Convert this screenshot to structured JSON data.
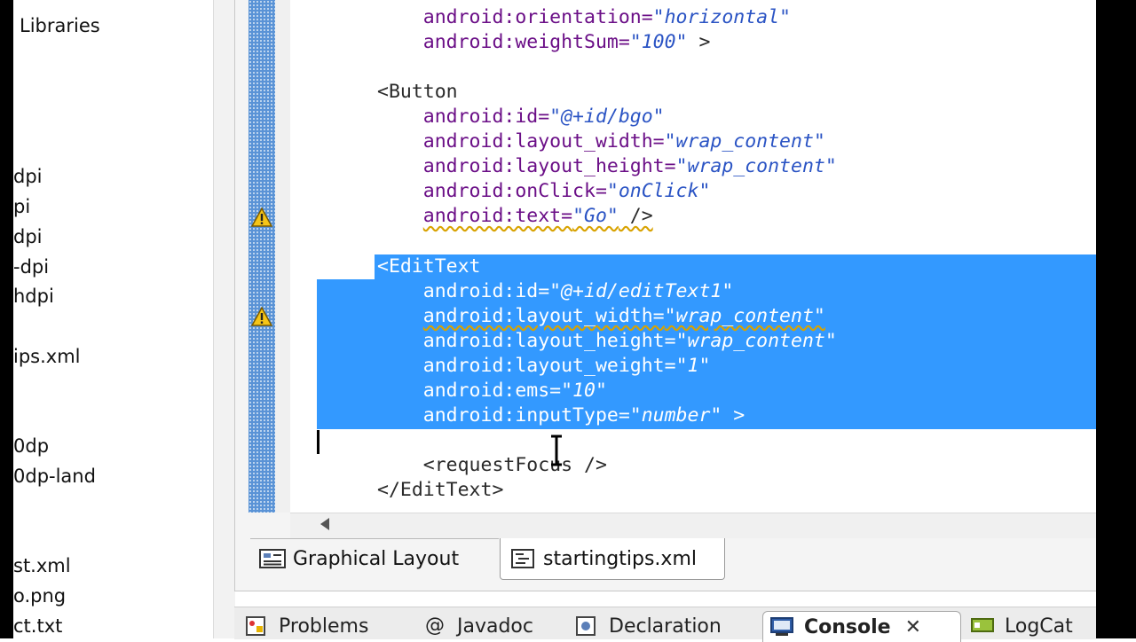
{
  "explorer": {
    "items": [
      "Libraries",
      "dpi",
      "pi",
      "dpi",
      "-dpi",
      "hdpi",
      "ips.xml",
      "0dp",
      "0dp-land",
      "st.xml",
      "o.png",
      "ct.txt"
    ]
  },
  "code": {
    "lines": [
      {
        "indent": "    ",
        "parts": [
          [
            "attr",
            "android:orientation="
          ],
          [
            "val",
            "\"horizontal\""
          ]
        ]
      },
      {
        "indent": "    ",
        "parts": [
          [
            "attr",
            "android:weightSum="
          ],
          [
            "val",
            "\"100\""
          ],
          [
            "tag",
            " >"
          ]
        ]
      },
      {
        "indent": "",
        "parts": []
      },
      {
        "indent": "",
        "parts": [
          [
            "tag",
            "<Button"
          ]
        ]
      },
      {
        "indent": "    ",
        "parts": [
          [
            "attr",
            "android:id="
          ],
          [
            "val",
            "\"@+id/bgo\""
          ]
        ]
      },
      {
        "indent": "    ",
        "parts": [
          [
            "attr",
            "android:layout_width="
          ],
          [
            "val",
            "\"wrap_content\""
          ]
        ]
      },
      {
        "indent": "    ",
        "parts": [
          [
            "attr",
            "android:layout_height="
          ],
          [
            "val",
            "\"wrap_content\""
          ]
        ]
      },
      {
        "indent": "    ",
        "parts": [
          [
            "attr",
            "android:onClick="
          ],
          [
            "val",
            "\"onClick\""
          ]
        ]
      },
      {
        "indent": "    ",
        "parts": [
          [
            "attr",
            "android:text="
          ],
          [
            "val",
            "\"Go\""
          ],
          [
            "tag",
            " />"
          ]
        ],
        "warning": true
      },
      {
        "indent": "",
        "parts": []
      },
      {
        "indent": "",
        "parts": [
          [
            "tag",
            "<EditText"
          ]
        ],
        "selected": true
      },
      {
        "indent": "    ",
        "parts": [
          [
            "attr",
            "android:id="
          ],
          [
            "val",
            "\"@+id/editText1\""
          ]
        ],
        "selected": true
      },
      {
        "indent": "    ",
        "parts": [
          [
            "attr",
            "android:layout_width="
          ],
          [
            "val",
            "\"wrap_content\""
          ]
        ],
        "selected": true,
        "warning": true
      },
      {
        "indent": "    ",
        "parts": [
          [
            "attr",
            "android:layout_height="
          ],
          [
            "val",
            "\"wrap_content\""
          ]
        ],
        "selected": true
      },
      {
        "indent": "    ",
        "parts": [
          [
            "attr",
            "android:layout_weight="
          ],
          [
            "val",
            "\"1\""
          ]
        ],
        "selected": true
      },
      {
        "indent": "    ",
        "parts": [
          [
            "attr",
            "android:ems="
          ],
          [
            "val",
            "\"10\""
          ]
        ],
        "selected": true
      },
      {
        "indent": "    ",
        "parts": [
          [
            "attr",
            "android:inputType="
          ],
          [
            "val",
            "\"number\""
          ],
          [
            "tag",
            " >"
          ]
        ],
        "selected": true
      },
      {
        "indent": "",
        "parts": []
      },
      {
        "indent": "    ",
        "parts": [
          [
            "tag",
            "<requestFocus />"
          ]
        ]
      },
      {
        "indent": "",
        "parts": [
          [
            "tag",
            "</EditText>"
          ]
        ]
      }
    ]
  },
  "editor_tabs": {
    "graphical": "Graphical Layout",
    "xml": "startingtips.xml"
  },
  "bottom_tabs": {
    "problems": "Problems",
    "javadoc": "Javadoc",
    "declaration": "Declaration",
    "console": "Console",
    "logcat": "LogCat"
  },
  "colors": {
    "selection": "#3399ff",
    "attribute": "#6b0f87",
    "value": "#2b54c4",
    "warning": "#d8a200"
  }
}
